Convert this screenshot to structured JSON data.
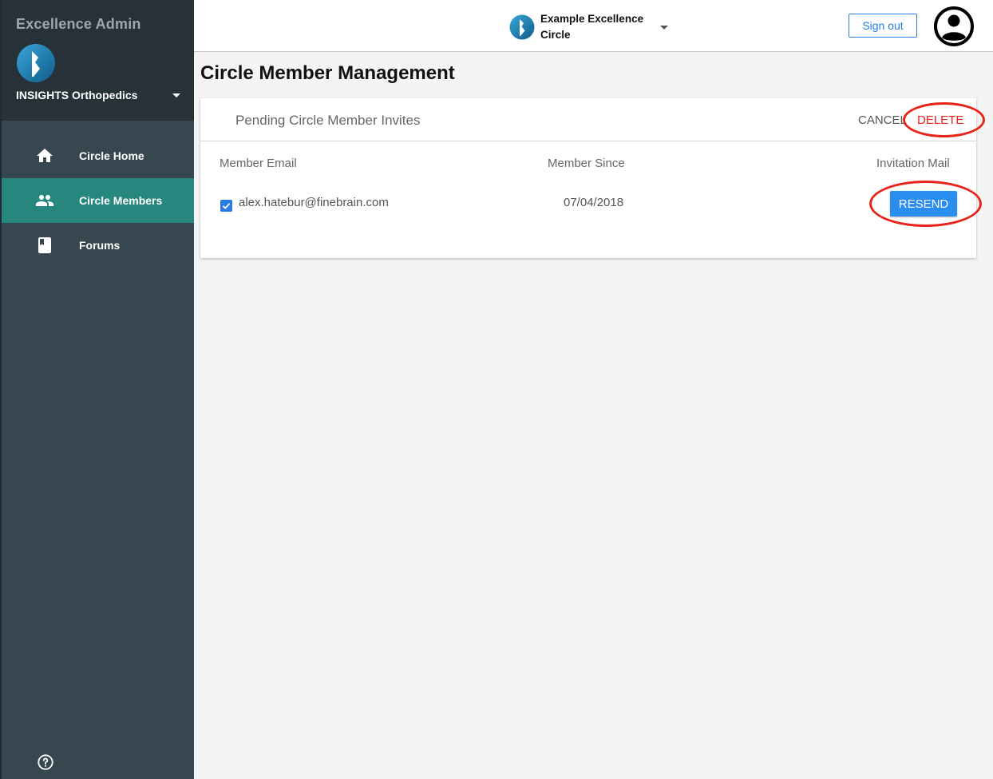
{
  "sidebar": {
    "app_title": "Excellence Admin",
    "org_name": "INSIGHTS Orthopedics",
    "items": [
      {
        "label": "Circle Home",
        "icon": "home-icon",
        "active": false
      },
      {
        "label": "Circle Members",
        "icon": "people-icon",
        "active": true
      },
      {
        "label": "Forums",
        "icon": "book-icon",
        "active": false
      }
    ],
    "help_icon": "help-circle-icon"
  },
  "header": {
    "circle_name": "Example Excellence Circle",
    "sign_out_label": "Sign out",
    "avatar_icon": "account-circle-icon"
  },
  "main": {
    "page_title": "Circle Member Management",
    "card": {
      "title": "Pending Circle Member Invites",
      "cancel_label": "CANCEL",
      "delete_label": "DELETE",
      "columns": [
        "Member Email",
        "Member Since",
        "Invitation Mail"
      ],
      "rows": [
        {
          "email": "alex.hatebur@finebrain.com",
          "since": "07/04/2018",
          "checked": true,
          "action_label": "RESEND"
        }
      ]
    }
  },
  "colors": {
    "sidebar_bg": "#37474f",
    "sidebar_top_bg": "#263238",
    "active_item": "#26877f",
    "primary": "#2a7be4",
    "annotation_red": "#e8241a"
  }
}
